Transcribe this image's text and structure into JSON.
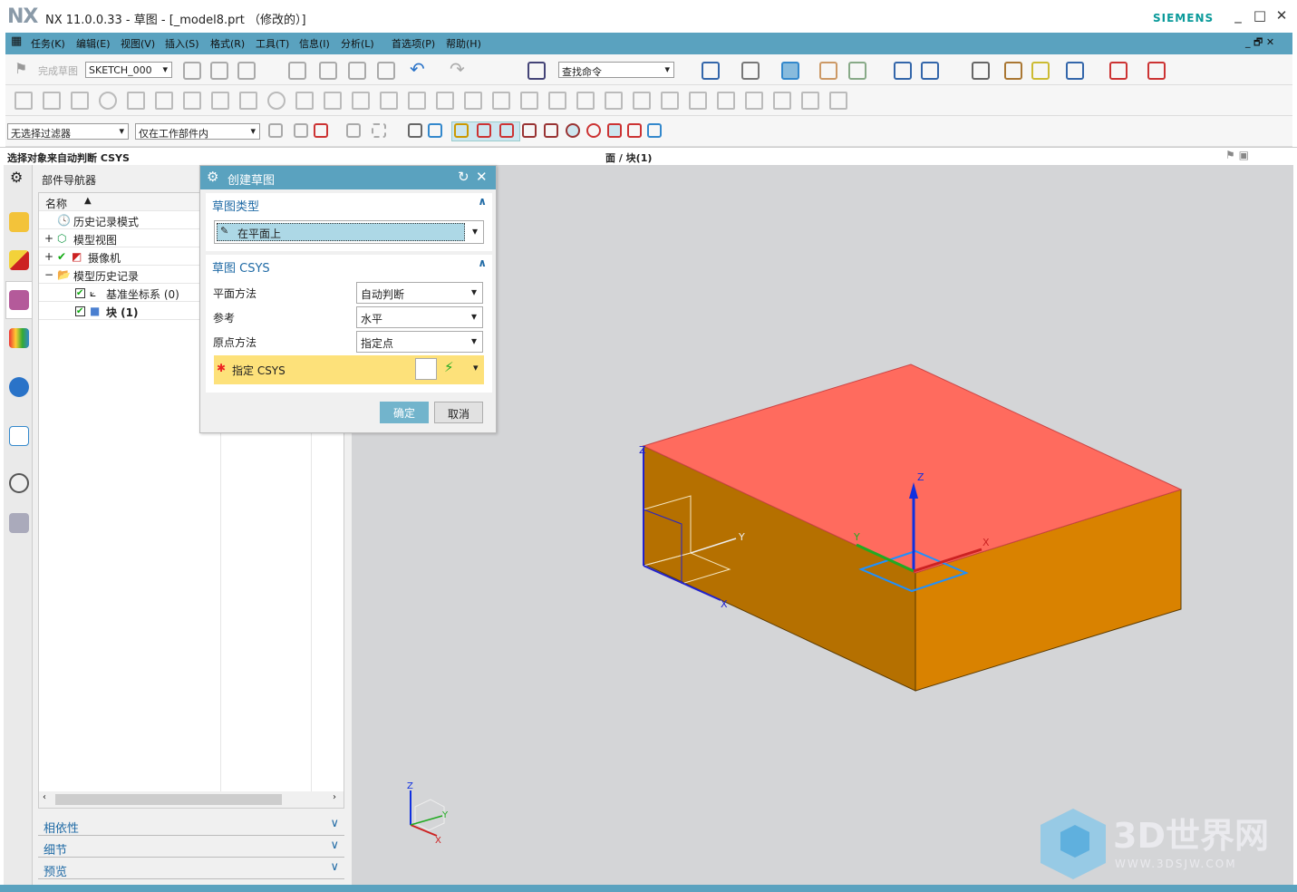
{
  "app": {
    "logo": "NX",
    "title": "NX 11.0.0.33 - 草图 - [_model8.prt （修改的）]",
    "brand": "SIEMENS",
    "win_min": "_",
    "win_max": "□",
    "win_close": "✕"
  },
  "menu": [
    "任务(K)",
    "编辑(E)",
    "视图(V)",
    "插入(S)",
    "格式(R)",
    "工具(T)",
    "信息(I)",
    "分析(L)",
    "首选项(P)",
    "帮助(H)"
  ],
  "toolbar": {
    "finish_sketch": "完成草图",
    "sketch_name": "SKETCH_000",
    "find_command": "查找命令",
    "filter": "无选择过滤器",
    "scope": "仅在工作部件内"
  },
  "status": {
    "prompt": "选择对象来自动判断 CSYS",
    "selection": "面 / 块(1)"
  },
  "navigator": {
    "title": "部件导航器",
    "column": "名称",
    "nodes": [
      {
        "label": "历史记录模式"
      },
      {
        "label": "模型视图"
      },
      {
        "label": "摄像机"
      },
      {
        "label": "模型历史记录"
      },
      {
        "label": "基准坐标系 (0)"
      },
      {
        "label": "块 (1)"
      }
    ],
    "panels": [
      "相依性",
      "细节",
      "预览"
    ]
  },
  "dialog": {
    "title": "创建草图",
    "section1": "草图类型",
    "sketch_type": "在平面上",
    "section2": "草图 CSYS",
    "fields": [
      {
        "label": "平面方法",
        "value": "自动判断"
      },
      {
        "label": "参考",
        "value": "水平"
      },
      {
        "label": "原点方法",
        "value": "指定点"
      }
    ],
    "specify_csys": "指定 CSYS",
    "ok": "确定",
    "cancel": "取消"
  },
  "viewport": {
    "axis_x": "X",
    "axis_y": "Y",
    "axis_z": "Z",
    "watermark": "3D世界网",
    "watermark_url": "WWW.3DSJW.COM"
  },
  "colors": {
    "accent": "#5aa2bf",
    "top_face": "#ff6b5e",
    "side_left": "#b57000",
    "side_right": "#d98200",
    "required": "#fde17a"
  }
}
